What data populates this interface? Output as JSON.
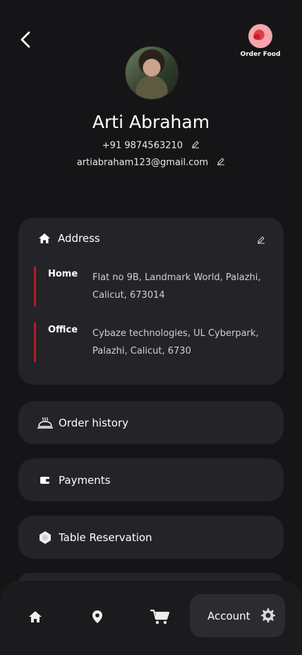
{
  "header": {
    "back_icon": "chevron-left-icon",
    "order_food_label": "Order Food"
  },
  "profile": {
    "name": "Arti Abraham",
    "phone": "+91 9874563210",
    "email": "artiabraham123@gmail.com"
  },
  "address": {
    "title": "Address",
    "items": [
      {
        "tag": "Home",
        "text": "Flat no 9B, Landmark World, Palazhi, Calicut, 673014"
      },
      {
        "tag": "Office",
        "text": "Cybaze technologies, UL Cyberpark, Palazhi, Calicut, 6730"
      }
    ],
    "accent": "#b51a24"
  },
  "menu": [
    {
      "label": "Order history",
      "icon": "food-tray-icon"
    },
    {
      "label": "Payments",
      "icon": "wallet-icon"
    },
    {
      "label": "Table Reservation",
      "icon": "table-icon"
    }
  ],
  "bottom_nav": {
    "items": [
      "home-icon",
      "location-pin-icon",
      "cart-icon"
    ],
    "active_label": "Account",
    "active_icon": "gear-icon"
  },
  "colors": {
    "background": "#151517",
    "card": "#242428",
    "nav": "#1b1b1e"
  }
}
